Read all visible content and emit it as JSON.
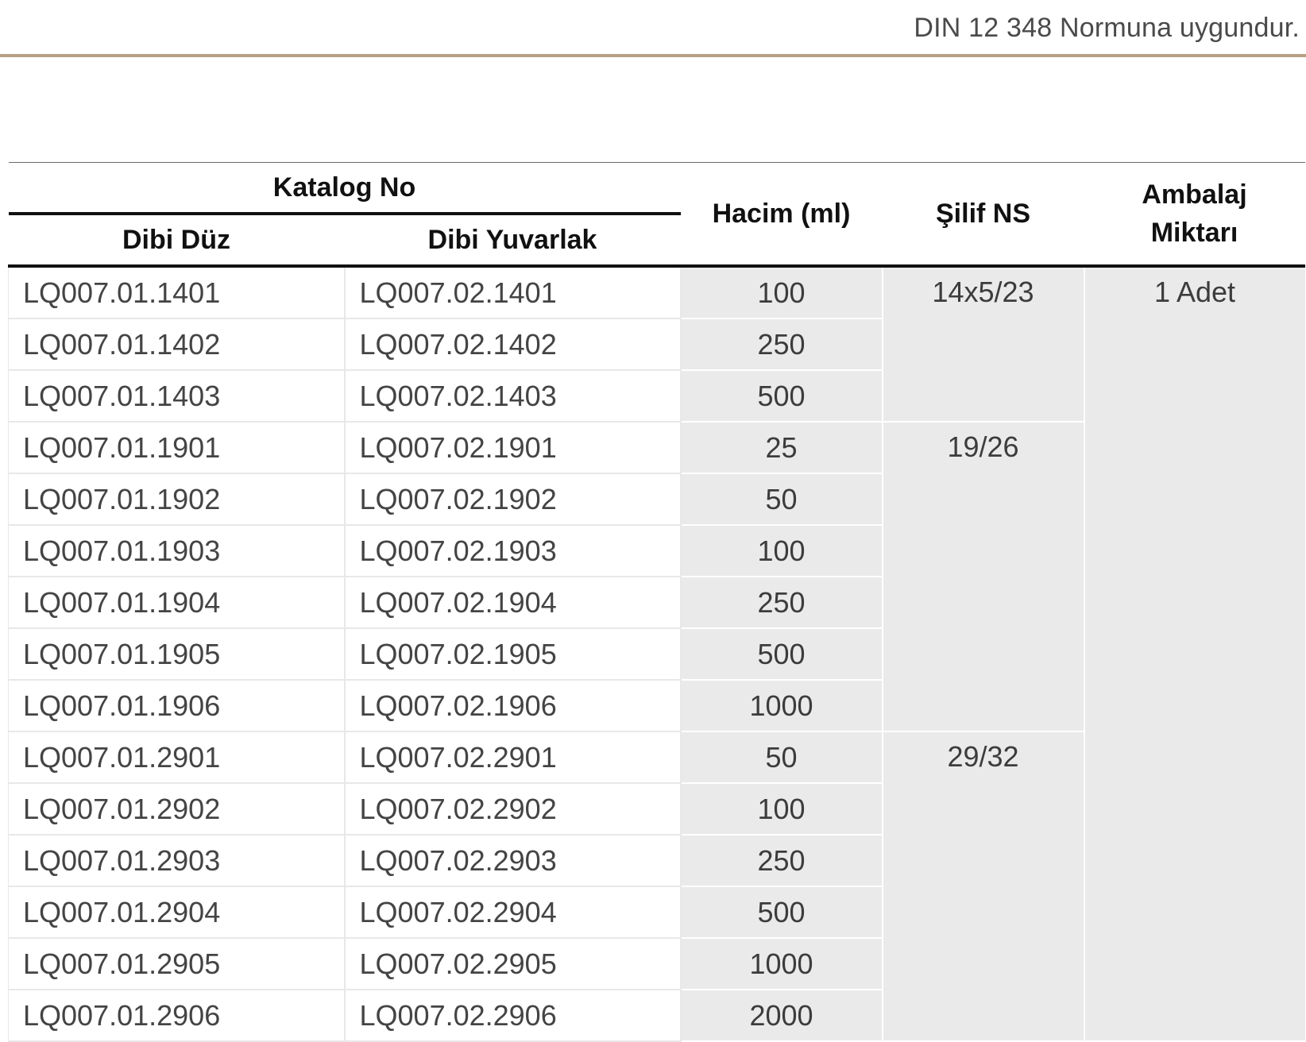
{
  "norm_note": "DIN 12 348 Normuna uygundur.",
  "table": {
    "headers": {
      "katalog_no": "Katalog No",
      "dibi_duz": "Dibi Düz",
      "dibi_yuvarlak": "Dibi Yuvarlak",
      "hacim": "Hacim (ml)",
      "silif": "Şilif NS",
      "ambalaj_line1": "Ambalaj",
      "ambalaj_line2": "Miktarı"
    },
    "rows": [
      {
        "duz": "LQ007.01.1401",
        "yuvarlak": "LQ007.02.1401",
        "hacim": "100"
      },
      {
        "duz": "LQ007.01.1402",
        "yuvarlak": "LQ007.02.1402",
        "hacim": "250"
      },
      {
        "duz": "LQ007.01.1403",
        "yuvarlak": "LQ007.02.1403",
        "hacim": "500"
      },
      {
        "duz": "LQ007.01.1901",
        "yuvarlak": "LQ007.02.1901",
        "hacim": "25"
      },
      {
        "duz": "LQ007.01.1902",
        "yuvarlak": "LQ007.02.1902",
        "hacim": "50"
      },
      {
        "duz": "LQ007.01.1903",
        "yuvarlak": "LQ007.02.1903",
        "hacim": "100"
      },
      {
        "duz": "LQ007.01.1904",
        "yuvarlak": "LQ007.02.1904",
        "hacim": "250"
      },
      {
        "duz": "LQ007.01.1905",
        "yuvarlak": "LQ007.02.1905",
        "hacim": "500"
      },
      {
        "duz": "LQ007.01.1906",
        "yuvarlak": "LQ007.02.1906",
        "hacim": "1000"
      },
      {
        "duz": "LQ007.01.2901",
        "yuvarlak": "LQ007.02.2901",
        "hacim": "50"
      },
      {
        "duz": "LQ007.01.2902",
        "yuvarlak": "LQ007.02.2902",
        "hacim": "100"
      },
      {
        "duz": "LQ007.01.2903",
        "yuvarlak": "LQ007.02.2903",
        "hacim": "250"
      },
      {
        "duz": "LQ007.01.2904",
        "yuvarlak": "LQ007.02.2904",
        "hacim": "500"
      },
      {
        "duz": "LQ007.01.2905",
        "yuvarlak": "LQ007.02.2905",
        "hacim": "1000"
      },
      {
        "duz": "LQ007.01.2906",
        "yuvarlak": "LQ007.02.2906",
        "hacim": "2000"
      }
    ],
    "silif_groups": [
      "14x5/23",
      "19/26",
      "29/32"
    ],
    "ambalaj_value": "1 Adet"
  }
}
